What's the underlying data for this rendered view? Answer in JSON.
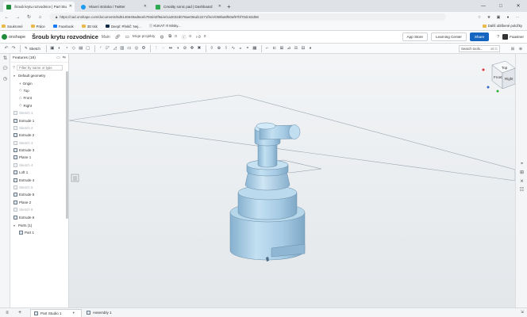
{
  "browser": {
    "tabs": [
      {
        "title": "Šroub krytu rozvodnice | Part Stu",
        "active": true,
        "favicon_color": "#1f8c3b"
      },
      {
        "title": "Hlavní stránka / Twitter",
        "active": false,
        "favicon_color": "#1d9bf0"
      },
      {
        "title": "Creality sonic pad | Dashboard",
        "active": false,
        "favicon_color": "#2fa84f"
      }
    ],
    "new_tab": "+",
    "window_controls": [
      "—",
      "□",
      "✕"
    ],
    "url": "https://cad.onshape.com/documents/5d6146649ad6eeb793d42f9a/w/1a3032d078ae09ad12271f/e/e/059ba8f50af97bf70dc63d58",
    "bookmarks": [
      "Soukromé",
      "Práce",
      "Facebook",
      "3D tisk",
      "Deepl: Překlč: Nej...",
      "Ⓘ KUKAT !!! Mísky..."
    ],
    "other_bookmarks": "Další oblíbené položky"
  },
  "app": {
    "logo": "onshape",
    "doc_title": "Šroub krytu rozvodnice",
    "branch": "Main",
    "project": "Moje projekty",
    "counters": [
      "0",
      "0",
      "0"
    ],
    "buttons": {
      "app_store": "App Store",
      "learning": "Learning Center",
      "share": "Share"
    },
    "user": "Faastner"
  },
  "toolbar": {
    "sketch_label": "Sketch",
    "search_placeholder": "Search tools...",
    "search_shortcut": "alt C"
  },
  "features": {
    "header": "Features (18)",
    "filter_placeholder": "Filter by name or type",
    "default_geometry": "Default geometry",
    "origin": [
      "Origin",
      "Top",
      "Front",
      "Right"
    ],
    "items": [
      {
        "label": "Sketch 1",
        "muted": true
      },
      {
        "label": "Extrude 1",
        "muted": false
      },
      {
        "label": "Sketch 2",
        "muted": true
      },
      {
        "label": "Extrude 2",
        "muted": false
      },
      {
        "label": "Sketch 3",
        "muted": true
      },
      {
        "label": "Extrude 3",
        "muted": false
      },
      {
        "label": "Plane 1",
        "muted": false
      },
      {
        "label": "Sketch 4",
        "muted": true
      },
      {
        "label": "Loft 1",
        "muted": false
      },
      {
        "label": "Extrude 4",
        "muted": false
      },
      {
        "label": "Sketch 5",
        "muted": true
      },
      {
        "label": "Extrude 5",
        "muted": false
      },
      {
        "label": "Plane 2",
        "muted": false
      },
      {
        "label": "Sketch 6",
        "muted": true
      },
      {
        "label": "Extrude 6",
        "muted": false
      }
    ],
    "parts_header": "Parts (1)",
    "parts": [
      "Part 1"
    ]
  },
  "view_cube": {
    "top": "Top",
    "front": "Front",
    "right": "Right"
  },
  "bottom_tabs": [
    {
      "label": "Part Studio 1",
      "active": true
    },
    {
      "label": "Assembly 1",
      "active": false
    }
  ],
  "colors": {
    "part": "#a9cfe8",
    "part_dark": "#7aa6c6",
    "accent": "#1565c0"
  }
}
